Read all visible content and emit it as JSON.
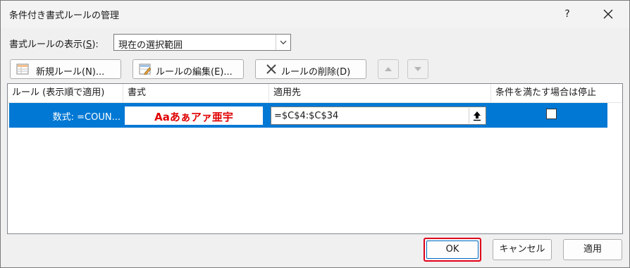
{
  "window": {
    "title": "条件付き書式ルールの管理",
    "help": "?"
  },
  "show_rules": {
    "label_prefix": "書式ルールの表示(",
    "label_key": "S",
    "label_suffix": "):",
    "selected": "現在の選択範囲"
  },
  "toolbar": {
    "new_rule": "新規ルール(N)...",
    "edit_rule": "ルールの編集(E)...",
    "delete_rule": "ルールの削除(D)"
  },
  "table": {
    "headers": [
      "ルール (表示順で適用)",
      "書式",
      "適用先",
      "条件を満たす場合は停止"
    ],
    "rows": [
      {
        "rule": "数式: =COUN...",
        "preview": "Aaあぁアァ亜宇",
        "applies_to": "=$C$4:$C$34",
        "stop_if_true": false
      }
    ]
  },
  "buttons": {
    "ok": "OK",
    "cancel": "キャンセル",
    "apply": "適用"
  },
  "colors": {
    "selection": "#0078d4",
    "preview_text": "#e00000",
    "highlight_frame": "#e0001b"
  }
}
